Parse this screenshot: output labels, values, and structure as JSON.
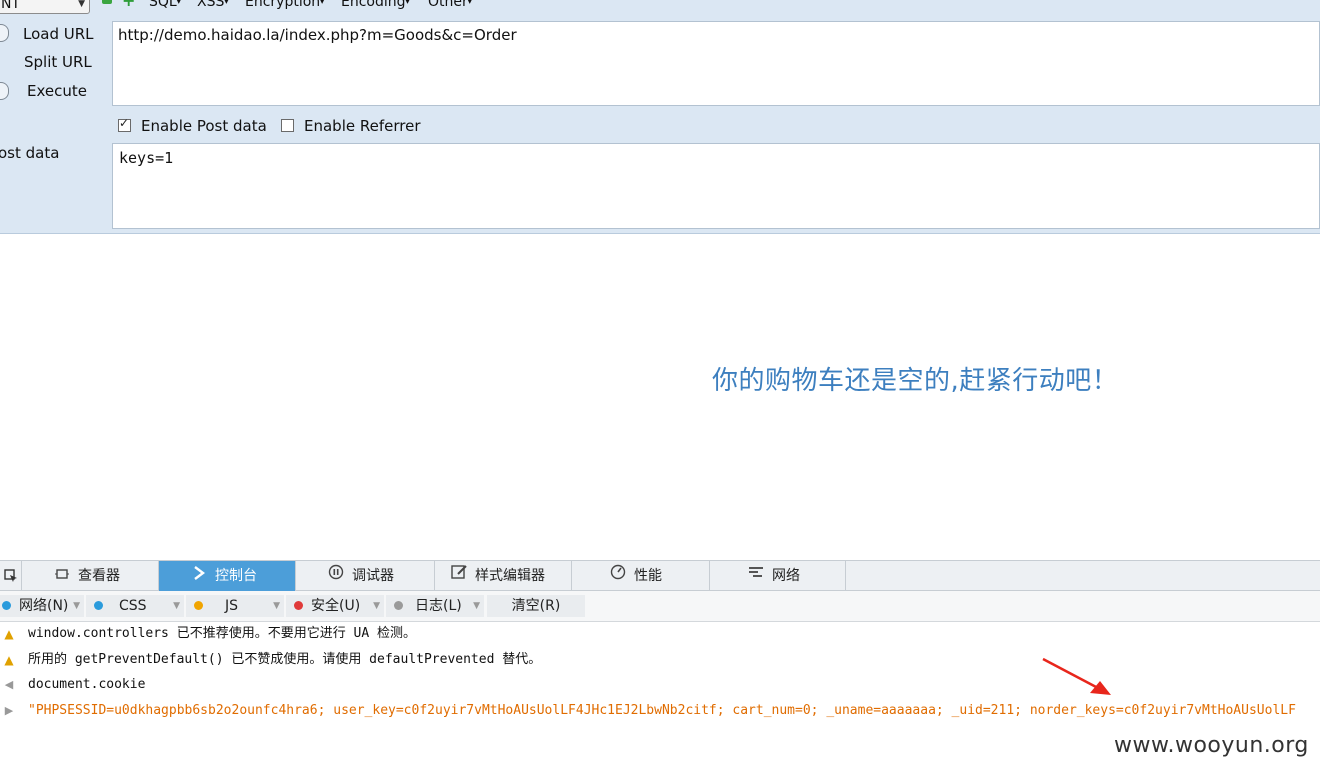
{
  "hackbar": {
    "select_value": "NT",
    "menus": [
      "SQL",
      "XSS",
      "Encryption",
      "Encoding",
      "Other"
    ],
    "load_url": "Load URL",
    "split_url": "Split URL",
    "execute": "Execute",
    "url_value": "http://demo.haidao.la/index.php?m=Goods&c=Order",
    "enable_post": "Enable Post data",
    "enable_post_checked": true,
    "enable_referrer": "Enable Referrer",
    "enable_referrer_checked": false,
    "post_label": "ost data",
    "post_value": "keys=1"
  },
  "page": {
    "cart_message": "你的购物车还是空的,赶紧行动吧！"
  },
  "devtools": {
    "tabs": [
      "查看器",
      "控制台",
      "调试器",
      "样式编辑器",
      "性能",
      "网络"
    ],
    "active_tab": "控制台",
    "filters": {
      "net": "网络(N)",
      "css": "CSS",
      "js": "JS",
      "security": "安全(U)",
      "log": "日志(L)",
      "clear": "清空(R)"
    },
    "colors": {
      "net": "#2a9bdc",
      "css": "#2a9bdc",
      "js": "#f0a400",
      "security": "#e03a3a",
      "log": "#9a9a9a"
    },
    "console": [
      {
        "kind": "warning",
        "text": "window.controllers 已不推荐使用。不要用它进行 UA 检测。"
      },
      {
        "kind": "warning",
        "text": "所用的 getPreventDefault() 已不赞成使用。请使用 defaultPrevented 替代。"
      },
      {
        "kind": "input",
        "text": "document.cookie"
      },
      {
        "kind": "result",
        "text": "\"PHPSESSID=u0dkhagpbb6sb2o2ounfc4hra6; user_key=c0f2uyir7vMtHoAUsUolLF4JHc1EJ2LbwNb2citf; cart_num=0; _uname=aaaaaaa; _uid=211; norder_keys=c0f2uyir7vMtHoAUsUolLF"
      }
    ]
  },
  "watermark": "www.wooyun.org"
}
